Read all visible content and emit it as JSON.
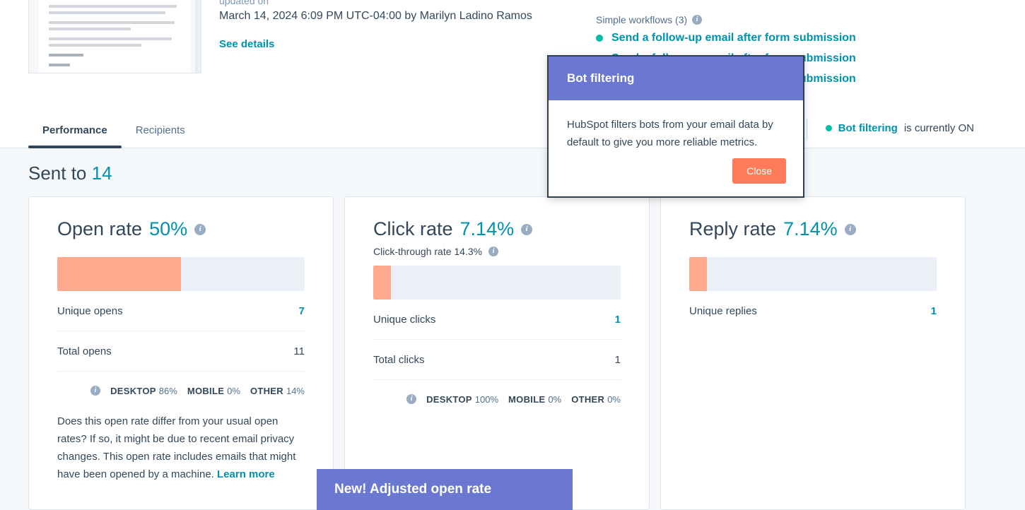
{
  "meta": {
    "updated_label": "updated on",
    "updated_value": "March 14, 2024 6:09 PM UTC-04:00 by Marilyn Ladino Ramos",
    "see_details": "See details"
  },
  "workflows": {
    "heading": "Simple workflows (3)",
    "info_icon": "info-icon",
    "items": [
      {
        "label": "Send a follow-up email after form submission"
      },
      {
        "label": "Send a follow-up email after form submission"
      },
      {
        "label": "Send a follow-up email after form submission"
      }
    ]
  },
  "tabs": [
    {
      "label": "Performance",
      "active": true
    },
    {
      "label": "Recipients",
      "active": false
    }
  ],
  "bot_status": {
    "bold": "Bot filtering",
    "rest": "is currently ON"
  },
  "summary": {
    "sent_to_label": "Sent to",
    "sent_to_value": "14"
  },
  "cards": [
    {
      "title": "Open rate",
      "percent": "50%",
      "subtitle": null,
      "bar_fill_pct": 50,
      "rows": [
        {
          "label": "Unique opens",
          "value": "7",
          "highlight": true
        },
        {
          "label": "Total opens",
          "value": "11",
          "highlight": false
        }
      ],
      "devices": [
        {
          "name": "DESKTOP",
          "value": "86%"
        },
        {
          "name": "MOBILE",
          "value": "0%"
        },
        {
          "name": "OTHER",
          "value": "14%"
        }
      ],
      "note": "Does this open rate differ from your usual open rates? If so, it might be due to recent email privacy changes. This open rate includes emails that might have been opened by a machine. ",
      "note_link": "Learn more"
    },
    {
      "title": "Click rate",
      "percent": "7.14%",
      "subtitle": "Click-through rate 14.3%",
      "bar_fill_pct": 7.14,
      "rows": [
        {
          "label": "Unique clicks",
          "value": "1",
          "highlight": true
        },
        {
          "label": "Total clicks",
          "value": "1",
          "highlight": false
        }
      ],
      "devices": [
        {
          "name": "DESKTOP",
          "value": "100%"
        },
        {
          "name": "MOBILE",
          "value": "0%"
        },
        {
          "name": "OTHER",
          "value": "0%"
        }
      ],
      "note": null,
      "note_link": null
    },
    {
      "title": "Reply rate",
      "percent": "7.14%",
      "subtitle": null,
      "bar_fill_pct": 7.14,
      "rows": [
        {
          "label": "Unique replies",
          "value": "1",
          "highlight": true
        }
      ],
      "devices": [],
      "note": null,
      "note_link": null
    }
  ],
  "modal": {
    "title": "Bot filtering",
    "body": "HubSpot filters bots from your email data by default to give you more reliable metrics.",
    "close_label": "Close"
  },
  "banner": {
    "text": "New! Adjusted open rate"
  },
  "colors": {
    "accent_teal": "#0091ae",
    "bar_fill": "#fca98e",
    "bar_track": "#eaf0f6",
    "status_green": "#00bda5",
    "modal_purple": "#6a78d1",
    "button_orange": "#ff7a59",
    "text_dark": "#33475b",
    "page_bg": "#f5f8fa"
  }
}
